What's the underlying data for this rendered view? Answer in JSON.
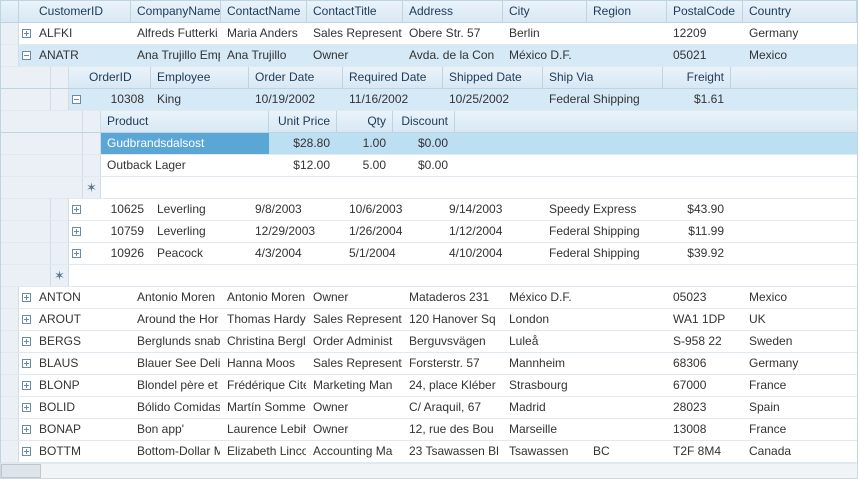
{
  "columns0": {
    "id": "CustomerID",
    "company": "CompanyName",
    "contact": "ContactName",
    "title": "ContactTitle",
    "address": "Address",
    "city": "City",
    "region": "Region",
    "postal": "PostalCode",
    "country": "Country"
  },
  "columns1": {
    "oid": "OrderID",
    "emp": "Employee",
    "odate": "Order Date",
    "rdate": "Required Date",
    "sdate": "Shipped Date",
    "via": "Ship Via",
    "freight": "Freight"
  },
  "columns2": {
    "product": "Product",
    "unitprice": "Unit Price",
    "qty": "Qty",
    "discount": "Discount"
  },
  "customers": [
    {
      "id": "ALFKI",
      "company": "Alfreds Futterki",
      "contact": "Maria Anders",
      "title": "Sales Represent",
      "address": "Obere Str. 57",
      "city": "Berlin",
      "region": "",
      "postal": "12209",
      "country": "Germany"
    },
    {
      "id": "ANATR",
      "company": "Ana Trujillo Emp",
      "contact": "Ana Trujillo",
      "title": "Owner",
      "address": "Avda. de la Con",
      "city": "México D.F.",
      "region": "",
      "postal": "05021",
      "country": "Mexico"
    },
    {
      "id": "ANTON",
      "company": "Antonio Moren",
      "contact": "Antonio Moren",
      "title": "Owner",
      "address": "Mataderos  231",
      "city": "México D.F.",
      "region": "",
      "postal": "05023",
      "country": "Mexico"
    },
    {
      "id": "AROUT",
      "company": "Around the Hor",
      "contact": "Thomas Hardy",
      "title": "Sales Represent",
      "address": "120 Hanover Sq",
      "city": "London",
      "region": "",
      "postal": "WA1 1DP",
      "country": "UK"
    },
    {
      "id": "BERGS",
      "company": "Berglunds snab",
      "contact": "Christina Berglu",
      "title": "Order Administ",
      "address": "Berguvsvägen  ",
      "city": "Luleå",
      "region": "",
      "postal": "S-958 22",
      "country": "Sweden"
    },
    {
      "id": "BLAUS",
      "company": "Blauer See Delik",
      "contact": "Hanna Moos",
      "title": "Sales Represent",
      "address": "Forsterstr. 57",
      "city": "Mannheim",
      "region": "",
      "postal": "68306",
      "country": "Germany"
    },
    {
      "id": "BLONP",
      "company": "Blondel père et",
      "contact": "Frédérique Cite",
      "title": "Marketing Man",
      "address": "24, place Kléber",
      "city": "Strasbourg",
      "region": "",
      "postal": "67000",
      "country": "France"
    },
    {
      "id": "BOLID",
      "company": "Bólido Comidas",
      "contact": "Martín Sommer",
      "title": "Owner",
      "address": "C/ Araquil, 67",
      "city": "Madrid",
      "region": "",
      "postal": "28023",
      "country": "Spain"
    },
    {
      "id": "BONAP",
      "company": "Bon app'",
      "contact": "Laurence Lebiha",
      "title": "Owner",
      "address": "12, rue des Bou",
      "city": "Marseille",
      "region": "",
      "postal": "13008",
      "country": "France"
    },
    {
      "id": "BOTTM",
      "company": "Bottom-Dollar M",
      "contact": "Elizabeth Lincol",
      "title": "Accounting Ma",
      "address": "23 Tsawassen Bl",
      "city": "Tsawassen",
      "region": "BC",
      "postal": "T2F 8M4",
      "country": "Canada"
    }
  ],
  "orders": [
    {
      "oid": "10308",
      "emp": "King",
      "odate": "10/19/2002",
      "rdate": "11/16/2002",
      "sdate": "10/25/2002",
      "via": "Federal Shipping",
      "freight": "$1.61"
    },
    {
      "oid": "10625",
      "emp": "Leverling",
      "odate": "9/8/2003",
      "rdate": "10/6/2003",
      "sdate": "9/14/2003",
      "via": "Speedy Express",
      "freight": "$43.90"
    },
    {
      "oid": "10759",
      "emp": "Leverling",
      "odate": "12/29/2003",
      "rdate": "1/26/2004",
      "sdate": "1/12/2004",
      "via": "Federal Shipping",
      "freight": "$11.99"
    },
    {
      "oid": "10926",
      "emp": "Peacock",
      "odate": "4/3/2004",
      "rdate": "5/1/2004",
      "sdate": "4/10/2004",
      "via": "Federal Shipping",
      "freight": "$39.92"
    }
  ],
  "lines": [
    {
      "product": "Gudbrandsdalsost",
      "unitprice": "$28.80",
      "qty": "1.00",
      "discount": "$0.00"
    },
    {
      "product": "Outback Lager",
      "unitprice": "$12.00",
      "qty": "5.00",
      "discount": "$0.00"
    }
  ]
}
